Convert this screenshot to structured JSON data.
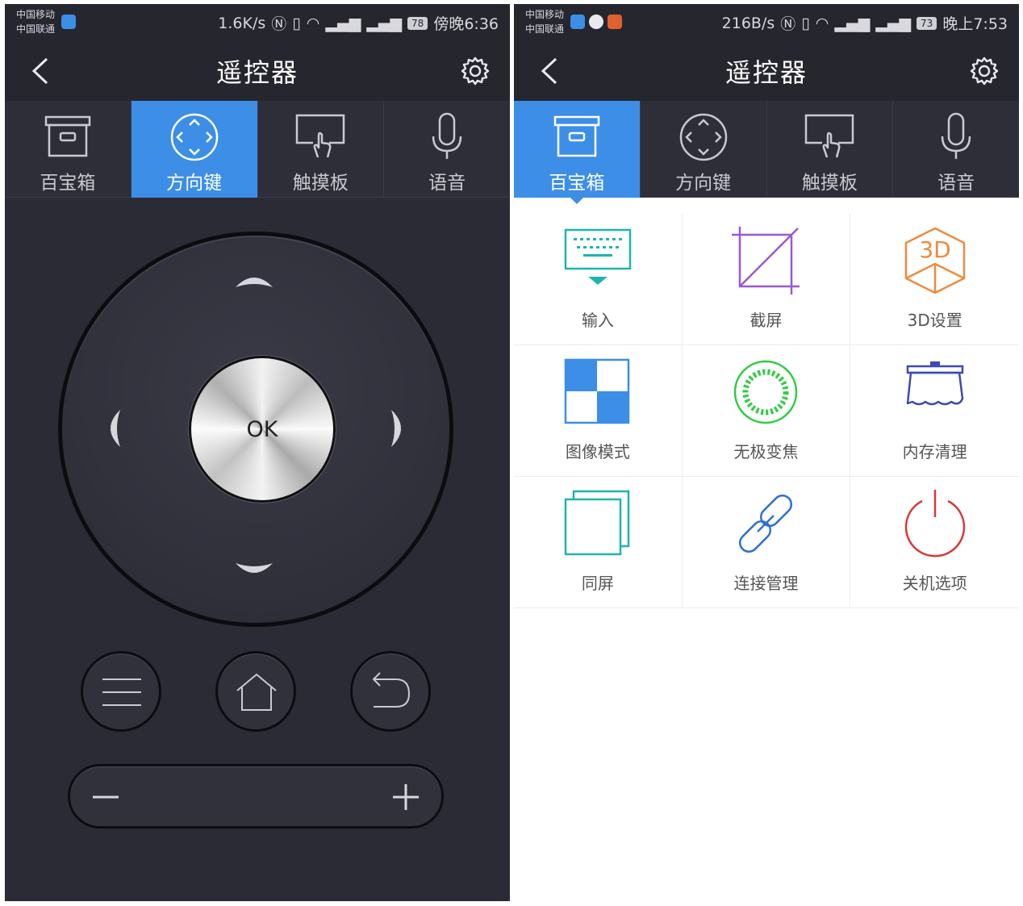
{
  "left_screen": {
    "status": {
      "carrier_1": "中国移动",
      "carrier_2": "中国联通",
      "speed": "1.6K/s",
      "battery": "78",
      "time": "傍晚6:36"
    },
    "title": "遥控器",
    "tabs": [
      {
        "label": "百宝箱",
        "icon": "archive-box-icon"
      },
      {
        "label": "方向键",
        "icon": "dpad-icon",
        "active": true
      },
      {
        "label": "触摸板",
        "icon": "touchpad-icon"
      },
      {
        "label": "语音",
        "icon": "microphone-icon"
      }
    ],
    "ok_label": "OK"
  },
  "right_screen": {
    "status": {
      "carrier_1": "中国移动",
      "carrier_2": "中国联通",
      "speed": "216B/s",
      "battery": "73",
      "time": "晚上7:53"
    },
    "title": "遥控器",
    "tabs": [
      {
        "label": "百宝箱",
        "icon": "archive-box-icon",
        "active": true
      },
      {
        "label": "方向键",
        "icon": "dpad-icon"
      },
      {
        "label": "触摸板",
        "icon": "touchpad-icon"
      },
      {
        "label": "语音",
        "icon": "microphone-icon"
      }
    ],
    "tools": [
      {
        "label": "输入",
        "icon": "keyboard-icon",
        "color": "#1fb5ad"
      },
      {
        "label": "截屏",
        "icon": "crop-icon",
        "color": "#9b59d0"
      },
      {
        "label": "3D设置",
        "icon": "3d-cube-icon",
        "color": "#f08a3c"
      },
      {
        "label": "图像模式",
        "icon": "image-mode-icon",
        "color": "#3d8ee6"
      },
      {
        "label": "无极变焦",
        "icon": "zoom-ring-icon",
        "color": "#2ecc40"
      },
      {
        "label": "内存清理",
        "icon": "memory-clean-icon",
        "color": "#3f4bb0"
      },
      {
        "label": "同屏",
        "icon": "mirror-screen-icon",
        "color": "#1fb5ad"
      },
      {
        "label": "连接管理",
        "icon": "link-icon",
        "color": "#2f6fd6"
      },
      {
        "label": "关机选项",
        "icon": "power-icon",
        "color": "#d63a3a"
      }
    ]
  },
  "colors": {
    "accent": "#3d8ee6",
    "dark_bg": "#2b2b35",
    "bar_bg": "#26262e"
  }
}
